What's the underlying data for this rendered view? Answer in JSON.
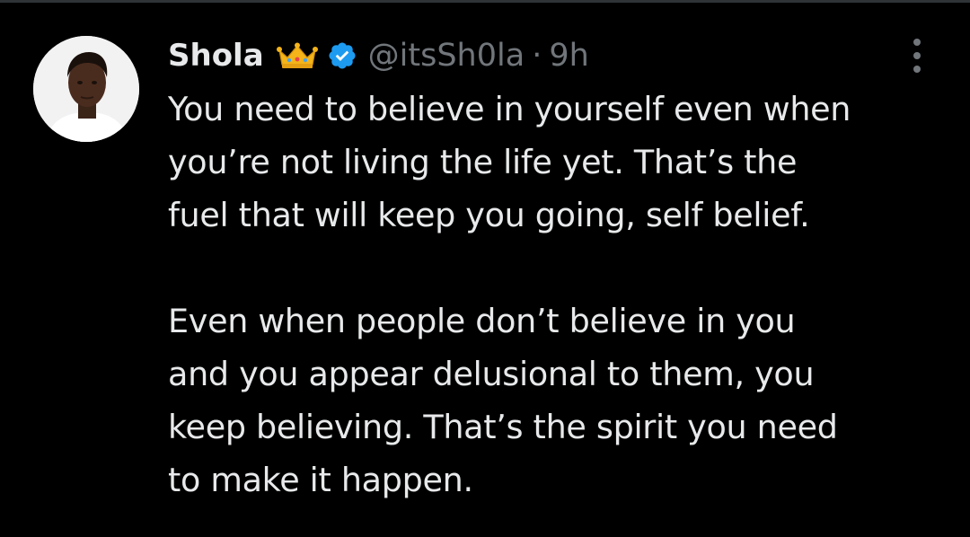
{
  "tweet": {
    "author": {
      "display_name": "Shola",
      "handle": "@itsSh0la",
      "badges": [
        "crown-emoji",
        "verified-badge"
      ]
    },
    "separator": "·",
    "timestamp": "9h",
    "paragraphs": [
      [
        "You need to believe in yourself even when",
        "you’re not living the life yet. That’s the",
        "fuel that will keep you going, self belief."
      ],
      [
        "Even when people don’t believe in you",
        "and you appear delusional to them, you",
        "keep believing. That’s the spirit you need",
        "to make it happen."
      ]
    ]
  },
  "colors": {
    "background": "#000000",
    "primary_text": "#e7e9ea",
    "secondary_text": "#71767b",
    "verified_blue": "#1d9bf0",
    "crown_gold": "#f4b41a"
  },
  "icons": {
    "more": "more-vertical-icon",
    "verified": "verified-check-icon",
    "crown": "crown-icon"
  }
}
